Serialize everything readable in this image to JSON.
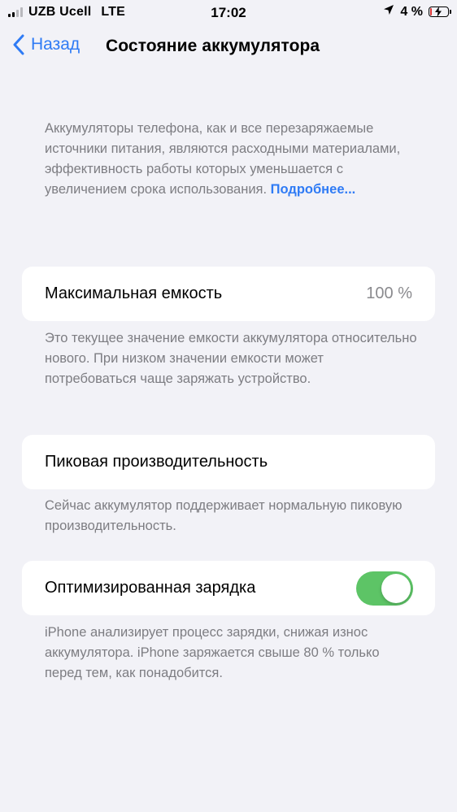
{
  "status_bar": {
    "carrier": "UZB Ucell",
    "network": "LTE",
    "time": "17:02",
    "battery_percent": "4 %",
    "icons": [
      "signal-icon",
      "location-arrow-icon",
      "battery-charging-icon"
    ]
  },
  "nav": {
    "back_label": "Назад",
    "title": "Состояние аккумулятора"
  },
  "intro": {
    "text": "Аккумуляторы телефона, как и все перезаряжаемые источники питания, являются расходными материалами, эффективность работы которых уменьшается с увеличением срока использования. ",
    "link": "Подробнее..."
  },
  "max_capacity": {
    "label": "Максимальная емкость",
    "value": "100 %",
    "footnote": "Это текущее значение емкости аккумулятора относительно нового. При низком значении емкости может потребоваться чаще заряжать устройство."
  },
  "peak_performance": {
    "label": "Пиковая производительность",
    "footnote": "Сейчас аккумулятор поддерживает нормальную пиковую производительность."
  },
  "optimized_charging": {
    "label": "Оптимизированная зарядка",
    "enabled": true,
    "footnote": "iPhone анализирует процесс зарядки, снижая износ аккумулятора. iPhone заряжается свыше 80 % только перед тем, как понадобится."
  },
  "colors": {
    "accent": "#2f7bf5",
    "toggle_on": "#5dc466",
    "background": "#f2f2f7",
    "secondary_text": "#7d7d82"
  }
}
